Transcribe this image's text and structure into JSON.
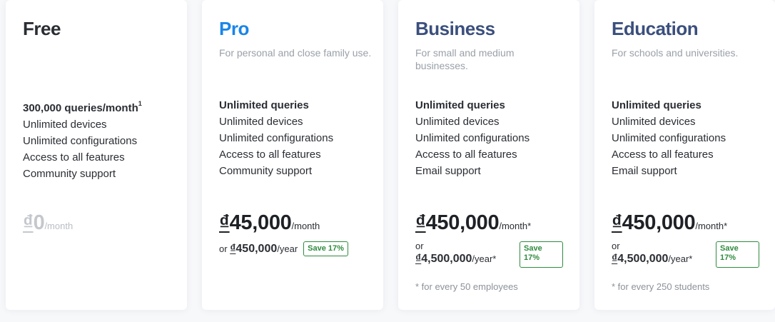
{
  "plans": [
    {
      "name": "Free",
      "description": "",
      "features": [
        "300,000 queries/month",
        "Unlimited devices",
        "Unlimited configurations",
        "Access to all features",
        "Community support"
      ],
      "feature_sup": "1",
      "price_currency": "₫",
      "price_amount": "0",
      "price_unit": "/month"
    },
    {
      "name": "Pro",
      "description": "For personal and close family use.",
      "features": [
        "Unlimited queries",
        "Unlimited devices",
        "Unlimited configurations",
        "Access to all features",
        "Community support"
      ],
      "price_currency": "₫",
      "price_amount": "45,000",
      "price_unit": "/month",
      "alt_prefix": "or",
      "alt_currency": "₫",
      "alt_amount": "450,000",
      "alt_unit": "/year",
      "save_label": "Save 17%"
    },
    {
      "name": "Business",
      "description": "For small and medium businesses.",
      "features": [
        "Unlimited queries",
        "Unlimited devices",
        "Unlimited configurations",
        "Access to all features",
        "Email support"
      ],
      "price_currency": "₫",
      "price_amount": "450,000",
      "price_unit": "/month*",
      "alt_prefix": "or",
      "alt_currency": "₫",
      "alt_amount": "4,500,000",
      "alt_unit": "/year*",
      "save_label": "Save 17%",
      "footnote": "* for every 50 employees"
    },
    {
      "name": "Education",
      "description": "For schools and universities.",
      "features": [
        "Unlimited queries",
        "Unlimited devices",
        "Unlimited configurations",
        "Access to all features",
        "Email support"
      ],
      "price_currency": "₫",
      "price_amount": "450,000",
      "price_unit": "/month*",
      "alt_prefix": "or",
      "alt_currency": "₫",
      "alt_amount": "4,500,000",
      "alt_unit": "/year*",
      "save_label": "Save 17%",
      "footnote": "* for every 250 students"
    }
  ],
  "colors": {
    "pro_accent": "#1a85e8",
    "business_accent": "#3b4f7d",
    "save_green": "#2e8b3e"
  }
}
